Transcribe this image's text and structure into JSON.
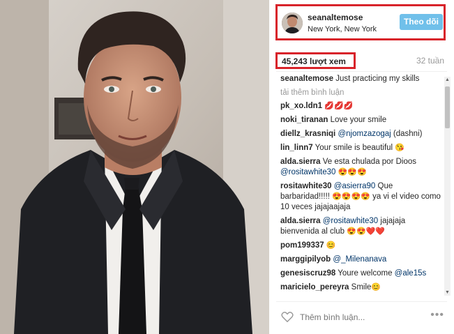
{
  "post": {
    "username": "seanaltemose",
    "location": "New York, New York",
    "follow_label": "Theo dõi",
    "views": "45,243 lượt xem",
    "age": "32 tuần",
    "caption_user": "seanaltemose",
    "caption_text": "Just practicing my skills",
    "load_more": "tải thêm bình luận"
  },
  "comments": [
    {
      "user": "pk_xo.ldn1",
      "parts": [
        {
          "t": "text",
          "v": ""
        },
        {
          "t": "emoji",
          "v": "💋💋💋"
        }
      ]
    },
    {
      "user": "noki_tiranan",
      "parts": [
        {
          "t": "text",
          "v": "Love your smile"
        }
      ]
    },
    {
      "user": "diellz_krasniqi",
      "parts": [
        {
          "t": "mention",
          "v": "@njomzazogaj"
        },
        {
          "t": "text",
          "v": " (dashni)"
        }
      ]
    },
    {
      "user": "lin_linn7",
      "parts": [
        {
          "t": "text",
          "v": "Your smile is beautiful "
        },
        {
          "t": "emoji",
          "v": "😘"
        }
      ]
    },
    {
      "user": "alda.sierra",
      "parts": [
        {
          "t": "text",
          "v": "Ve esta chulada por Dioos "
        },
        {
          "t": "mention",
          "v": "@rositawhite30"
        },
        {
          "t": "text",
          "v": " "
        },
        {
          "t": "emoji",
          "v": "😍😍😍"
        }
      ]
    },
    {
      "user": "rositawhite30",
      "parts": [
        {
          "t": "mention",
          "v": "@asierra90"
        },
        {
          "t": "text",
          "v": " Que barbaridad!!!!! "
        },
        {
          "t": "emoji",
          "v": "😍😍😍😍"
        },
        {
          "t": "text",
          "v": " ya vi el video como 10 veces jajajaajaja"
        }
      ]
    },
    {
      "user": "alda.sierra",
      "parts": [
        {
          "t": "mention",
          "v": "@rositawhite30"
        },
        {
          "t": "text",
          "v": " jajajaja bienvenida al club "
        },
        {
          "t": "emoji",
          "v": "😍😍❤️❤️"
        }
      ]
    },
    {
      "user": "pom199337",
      "parts": [
        {
          "t": "emoji",
          "v": "😊"
        }
      ]
    },
    {
      "user": "marggipilyob",
      "parts": [
        {
          "t": "mention",
          "v": "@_Milenanava"
        }
      ]
    },
    {
      "user": "genesiscruz98",
      "parts": [
        {
          "t": "text",
          "v": "Youre welcome "
        },
        {
          "t": "mention",
          "v": "@ale15s"
        }
      ]
    },
    {
      "user": "maricielo_pereyra",
      "parts": [
        {
          "t": "text",
          "v": "Smile"
        },
        {
          "t": "emoji",
          "v": "😊"
        }
      ]
    }
  ],
  "footer": {
    "add_comment_placeholder": "Thêm bình luận...",
    "more_label": "•••"
  },
  "colors": {
    "highlight_box": "#d8232a",
    "follow_button": "#70c0ea",
    "mention": "#003569",
    "muted": "#999999"
  },
  "icons": [
    "heart-icon",
    "more-options-icon",
    "scroll-up-arrow-icon",
    "scroll-down-arrow-icon"
  ]
}
